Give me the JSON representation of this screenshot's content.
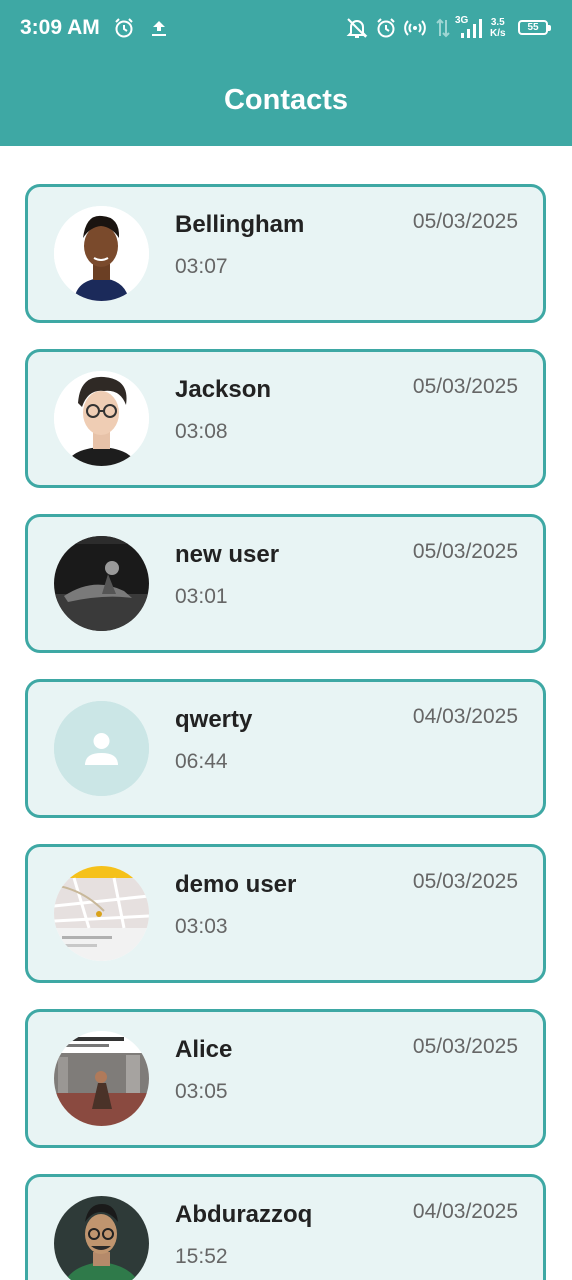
{
  "status_bar": {
    "time": "3:09 AM",
    "network": "3G",
    "speed_value": "3.5",
    "speed_unit": "K/s",
    "battery": "55",
    "icons": [
      "alarm-icon",
      "upload-icon",
      "notifications-off-icon",
      "alarm-icon",
      "hotspot-icon",
      "data-transfer-icon",
      "signal-icon",
      "battery-icon"
    ]
  },
  "header": {
    "title": "Contacts"
  },
  "colors": {
    "primary": "#3ea8a4",
    "card_bg": "#e8f4f4",
    "placeholder_avatar": "#cbe6e6"
  },
  "contacts": [
    {
      "name": "Bellingham",
      "time": "03:07",
      "date": "05/03/2025",
      "avatar": "photo"
    },
    {
      "name": "Jackson",
      "time": "03:08",
      "date": "05/03/2025",
      "avatar": "photo"
    },
    {
      "name": "new user",
      "time": "03:01",
      "date": "05/03/2025",
      "avatar": "photo"
    },
    {
      "name": "qwerty",
      "time": "06:44",
      "date": "04/03/2025",
      "avatar": "person-placeholder-icon"
    },
    {
      "name": "demo user",
      "time": "03:03",
      "date": "05/03/2025",
      "avatar": "photo"
    },
    {
      "name": "Alice",
      "time": "03:05",
      "date": "05/03/2025",
      "avatar": "photo"
    },
    {
      "name": "Abdurazzoq",
      "time": "15:52",
      "date": "04/03/2025",
      "avatar": "photo"
    }
  ]
}
